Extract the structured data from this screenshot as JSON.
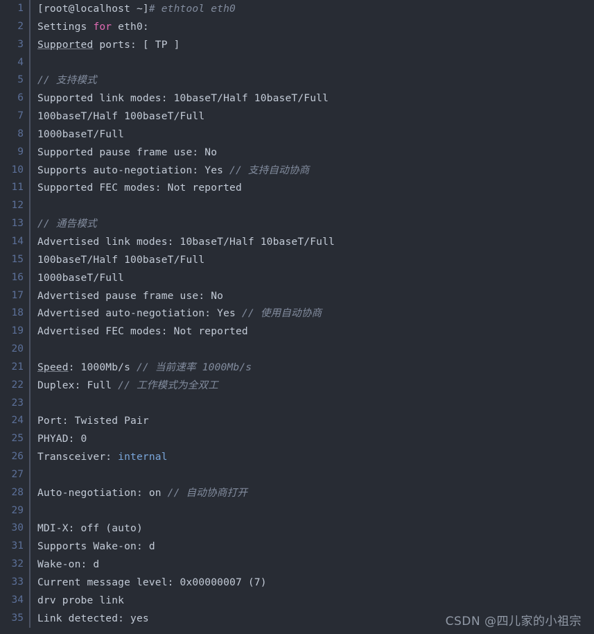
{
  "viewer": {
    "type": "code-block",
    "language": "shell",
    "background_color": "#282c34",
    "gutter_color": "#5c7099",
    "text_color": "#c3cbd7",
    "comment_color": "#828c9e",
    "keyword_color": "#e06bb4",
    "value_color": "#7aa6da",
    "first_line_number": 1,
    "last_line_number": 35,
    "total_lines": 35
  },
  "watermark": {
    "text": "CSDN @四儿家的小祖宗"
  },
  "lines": [
    {
      "n": "1",
      "tokens": [
        {
          "t": "[root@localhost ~]",
          "c": "t-plain"
        },
        {
          "t": "# ethtool eth0",
          "c": "t-comment"
        }
      ]
    },
    {
      "n": "2",
      "tokens": [
        {
          "t": "Settings ",
          "c": "t-plain"
        },
        {
          "t": "for",
          "c": "t-keyword"
        },
        {
          "t": " eth0:",
          "c": "t-plain"
        }
      ]
    },
    {
      "n": "3",
      "tokens": [
        {
          "t": "Supported",
          "c": "t-plain t-underline"
        },
        {
          "t": " ports: [ TP ]",
          "c": "t-plain"
        }
      ]
    },
    {
      "n": "4",
      "tokens": [
        {
          "t": "",
          "c": "t-plain"
        }
      ]
    },
    {
      "n": "5",
      "tokens": [
        {
          "t": "// ",
          "c": "t-comment"
        },
        {
          "t": "支持模式",
          "c": "t-comment cjk"
        }
      ]
    },
    {
      "n": "6",
      "tokens": [
        {
          "t": "Supported link modes: 10baseT/Half 10baseT/Full",
          "c": "t-plain"
        }
      ]
    },
    {
      "n": "7",
      "tokens": [
        {
          "t": "100baseT/Half 100baseT/Full",
          "c": "t-plain"
        }
      ]
    },
    {
      "n": "8",
      "tokens": [
        {
          "t": "1000baseT/Full",
          "c": "t-plain"
        }
      ]
    },
    {
      "n": "9",
      "tokens": [
        {
          "t": "Supported pause frame use: No",
          "c": "t-plain"
        }
      ]
    },
    {
      "n": "10",
      "tokens": [
        {
          "t": "Supports auto-negotiation: Yes ",
          "c": "t-plain"
        },
        {
          "t": "// ",
          "c": "t-comment"
        },
        {
          "t": "支持自动协商",
          "c": "t-comment cjk"
        }
      ]
    },
    {
      "n": "11",
      "tokens": [
        {
          "t": "Supported FEC modes: Not reported",
          "c": "t-plain"
        }
      ]
    },
    {
      "n": "12",
      "tokens": [
        {
          "t": "",
          "c": "t-plain"
        }
      ]
    },
    {
      "n": "13",
      "tokens": [
        {
          "t": "// ",
          "c": "t-comment"
        },
        {
          "t": "通告模式",
          "c": "t-comment cjk"
        }
      ]
    },
    {
      "n": "14",
      "tokens": [
        {
          "t": "Advertised link modes: 10baseT/Half 10baseT/Full",
          "c": "t-plain"
        }
      ]
    },
    {
      "n": "15",
      "tokens": [
        {
          "t": "100baseT/Half 100baseT/Full",
          "c": "t-plain"
        }
      ]
    },
    {
      "n": "16",
      "tokens": [
        {
          "t": "1000baseT/Full",
          "c": "t-plain"
        }
      ]
    },
    {
      "n": "17",
      "tokens": [
        {
          "t": "Advertised pause frame use: No",
          "c": "t-plain"
        }
      ]
    },
    {
      "n": "18",
      "tokens": [
        {
          "t": "Advertised auto-negotiation: Yes ",
          "c": "t-plain"
        },
        {
          "t": "// ",
          "c": "t-comment"
        },
        {
          "t": "使用自动协商",
          "c": "t-comment cjk"
        }
      ]
    },
    {
      "n": "19",
      "tokens": [
        {
          "t": "Advertised FEC modes: Not reported",
          "c": "t-plain"
        }
      ]
    },
    {
      "n": "20",
      "tokens": [
        {
          "t": "",
          "c": "t-plain"
        }
      ]
    },
    {
      "n": "21",
      "tokens": [
        {
          "t": "Speed",
          "c": "t-plain t-underline"
        },
        {
          "t": ": 1000Mb/s ",
          "c": "t-plain"
        },
        {
          "t": "// ",
          "c": "t-comment"
        },
        {
          "t": "当前速率",
          "c": "t-comment cjk"
        },
        {
          "t": " 1000Mb/s",
          "c": "t-comment"
        }
      ]
    },
    {
      "n": "22",
      "tokens": [
        {
          "t": "Duplex: Full ",
          "c": "t-plain"
        },
        {
          "t": "// ",
          "c": "t-comment"
        },
        {
          "t": "工作模式为全双工",
          "c": "t-comment cjk"
        }
      ]
    },
    {
      "n": "23",
      "tokens": [
        {
          "t": "",
          "c": "t-plain"
        }
      ]
    },
    {
      "n": "24",
      "tokens": [
        {
          "t": "Port: Twisted Pair",
          "c": "t-plain"
        }
      ]
    },
    {
      "n": "25",
      "tokens": [
        {
          "t": "PHYAD: 0",
          "c": "t-plain"
        }
      ]
    },
    {
      "n": "26",
      "tokens": [
        {
          "t": "Transceiver: ",
          "c": "t-plain"
        },
        {
          "t": "internal",
          "c": "t-value"
        }
      ]
    },
    {
      "n": "27",
      "tokens": [
        {
          "t": "",
          "c": "t-plain"
        }
      ]
    },
    {
      "n": "28",
      "tokens": [
        {
          "t": "Auto-negotiation: on ",
          "c": "t-plain"
        },
        {
          "t": "// ",
          "c": "t-comment"
        },
        {
          "t": "自动协商打开",
          "c": "t-comment cjk"
        }
      ]
    },
    {
      "n": "29",
      "tokens": [
        {
          "t": "",
          "c": "t-plain"
        }
      ]
    },
    {
      "n": "30",
      "tokens": [
        {
          "t": "MDI-X: off (auto)",
          "c": "t-plain"
        }
      ]
    },
    {
      "n": "31",
      "tokens": [
        {
          "t": "Supports Wake-on: d",
          "c": "t-plain"
        }
      ]
    },
    {
      "n": "32",
      "tokens": [
        {
          "t": "Wake-on: d",
          "c": "t-plain"
        }
      ]
    },
    {
      "n": "33",
      "tokens": [
        {
          "t": "Current message level: 0x00000007 (7)",
          "c": "t-plain"
        }
      ]
    },
    {
      "n": "34",
      "tokens": [
        {
          "t": "drv probe link",
          "c": "t-plain"
        }
      ]
    },
    {
      "n": "35",
      "tokens": [
        {
          "t": "Link detected: yes",
          "c": "t-plain"
        }
      ]
    }
  ]
}
